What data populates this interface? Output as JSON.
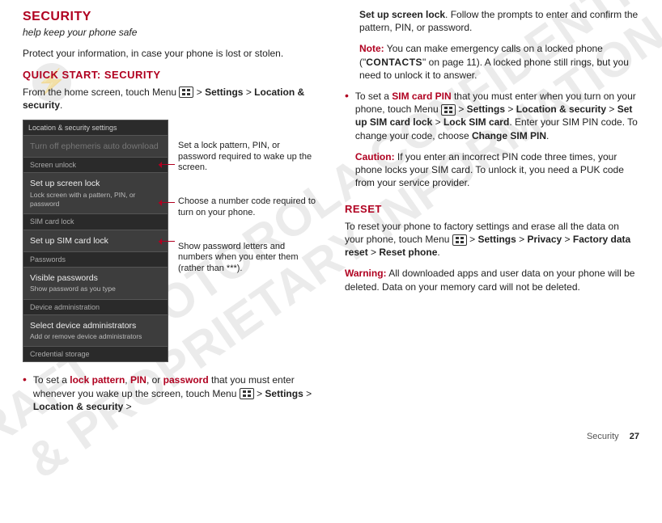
{
  "page": {
    "section_label": "Security",
    "page_number": "27"
  },
  "watermark": {
    "text": "DRAFT - MOTOROLA CONFIDENTIAL\n& PROPRIETARY INFORMATION"
  },
  "left": {
    "title": "SECURITY",
    "tagline": "help keep your phone safe",
    "intro": "Protect your information, in case your phone is lost or stolen.",
    "quick_title": "QUICK START: SECURITY",
    "quick_body_pre": "From the home screen, touch Menu ",
    "quick_body_mid": " > ",
    "quick_body_settings": "Settings",
    "quick_body_gt": " > ",
    "quick_body_loc": "Location & security",
    "quick_body_end": ".",
    "phone": {
      "title": "Location & security settings",
      "row0": "Turn off ephemeris auto download",
      "hdr_unlock": "Screen unlock",
      "row_screen_lock": "Set up screen lock",
      "row_screen_lock_sub": "Lock screen with a pattern, PIN, or password",
      "hdr_sim": "SIM card lock",
      "row_sim": "Set up SIM card lock",
      "hdr_pw": "Passwords",
      "row_visible": "Visible passwords",
      "row_visible_sub": "Show password as you type",
      "hdr_admin": "Device administration",
      "row_admin": "Select device administrators",
      "row_admin_sub": "Add or remove device administrators",
      "hdr_cred": "Credential storage"
    },
    "callout1": "Set a lock pattern, PIN, or password required to wake up the screen.",
    "callout2": "Choose a number code required to turn on your phone.",
    "callout3": "Show password letters and numbers when you enter them (rather than ***).",
    "bullet1_pre": "To set a ",
    "bullet1_lp": "lock pattern",
    "bullet1_c1": ", ",
    "bullet1_pin": "PIN",
    "bullet1_c2": ", or ",
    "bullet1_pw": "password",
    "bullet1_body": " that you must enter whenever you wake up the screen, touch Menu ",
    "bullet1_gt1": " > ",
    "bullet1_settings": "Settings",
    "bullet1_gt2": " > ",
    "bullet1_loc": "Location & security",
    "bullet1_gt3": " > "
  },
  "right": {
    "cont_lock": "Set up screen lock",
    "cont_body": ". Follow the prompts to enter and confirm the pattern, PIN, or password.",
    "note_label": "Note:",
    "note_body_pre": " You can make emergency calls on a locked phone (\"",
    "note_contacts": "CONTACTS",
    "note_body_post": "\" on page 11). A locked phone still rings, but you need to unlock it to answer.",
    "bullet2_pre": "To set a ",
    "bullet2_sim": "SIM card PIN",
    "bullet2_body1": " that you must enter when you turn on your phone, touch Menu ",
    "bullet2_gt1": " > ",
    "bullet2_settings": "Settings",
    "bullet2_gt2": " > ",
    "bullet2_loc": "Location & security",
    "bullet2_gt3": " > ",
    "bullet2_setup": "Set up SIM card lock",
    "bullet2_gt4": " > ",
    "bullet2_lock": "Lock SIM card",
    "bullet2_body2": ". Enter your SIM PIN code. To change your code, choose ",
    "bullet2_change": "Change SIM PIN",
    "bullet2_end": ".",
    "caution_label": "Caution:",
    "caution_body": " If you enter an incorrect PIN code three times, your phone locks your SIM card. To unlock it, you need a PUK code from your service provider.",
    "reset_title": "RESET",
    "reset_body_pre": "To reset your phone to factory settings and erase all the data on your phone, touch Menu ",
    "reset_gt1": " > ",
    "reset_settings": "Settings",
    "reset_gt2": " > ",
    "reset_privacy": "Privacy",
    "reset_gt3": " > ",
    "reset_fdr": "Factory data reset",
    "reset_gt4": " > ",
    "reset_rp": "Reset phone",
    "reset_end": ".",
    "warn_label": "Warning:",
    "warn_body": " All downloaded apps and user data on your phone will be deleted. Data on your memory card will not be deleted."
  }
}
